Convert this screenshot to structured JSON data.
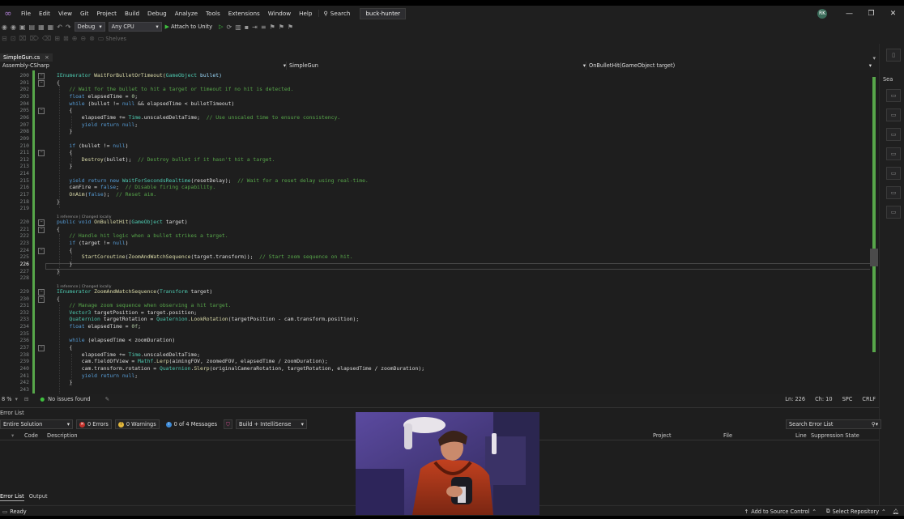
{
  "menu": {
    "items": [
      "File",
      "Edit",
      "View",
      "Git",
      "Project",
      "Build",
      "Debug",
      "Analyze",
      "Tools",
      "Extensions",
      "Window",
      "Help"
    ],
    "search_label": "Search",
    "solution_name": "buck-hunter",
    "user_initials": "RK"
  },
  "toolbar": {
    "config": "Debug",
    "platform": "Any CPU",
    "run_label": "Attach to Unity",
    "shelves_label": "Shelves"
  },
  "tab": {
    "filename": "SimpleGun.cs",
    "close": "×"
  },
  "navbar": {
    "project": "Assembly-CSharp",
    "type": "SimpleGun",
    "member": "OnBulletHit(GameObject target)"
  },
  "code_lines": [
    {
      "n": "200",
      "tokens": [
        [
          "IEnumerator ",
          "ty"
        ],
        [
          "WaitForBulletOrTimeout(",
          "mt"
        ],
        [
          "GameObject",
          "ty"
        ],
        [
          " bullet)",
          "va"
        ]
      ]
    },
    {
      "n": "201",
      "tokens": [
        [
          "{",
          ""
        ]
      ]
    },
    {
      "n": "202",
      "tokens": [
        [
          "    // Wait for the bullet to hit a target or timeout if no hit is detected.",
          "cm"
        ]
      ]
    },
    {
      "n": "203",
      "tokens": [
        [
          "    float ",
          "kw"
        ],
        [
          "elapsedTime = ",
          ""
        ],
        [
          "0",
          "nu"
        ],
        [
          ";",
          ""
        ]
      ]
    },
    {
      "n": "204",
      "tokens": [
        [
          "    while ",
          "kw"
        ],
        [
          "(bullet != ",
          ""
        ],
        [
          "null",
          "kw"
        ],
        [
          " && elapsedTime < bulletTimeout)",
          ""
        ]
      ]
    },
    {
      "n": "205",
      "tokens": [
        [
          "    {",
          ""
        ]
      ]
    },
    {
      "n": "206",
      "tokens": [
        [
          "        elapsedTime += ",
          ""
        ],
        [
          "Time",
          "ty"
        ],
        [
          ".unscaledDeltaTime;  ",
          ""
        ],
        [
          "// Use unscaled time to ensure consistency.",
          "cm"
        ]
      ]
    },
    {
      "n": "207",
      "tokens": [
        [
          "        yield return ",
          "kw"
        ],
        [
          "null",
          "kw"
        ],
        [
          ";",
          ""
        ]
      ]
    },
    {
      "n": "208",
      "tokens": [
        [
          "    }",
          ""
        ]
      ]
    },
    {
      "n": "209",
      "tokens": [
        [
          "",
          ""
        ]
      ]
    },
    {
      "n": "210",
      "tokens": [
        [
          "    if ",
          "kw"
        ],
        [
          "(bullet != ",
          ""
        ],
        [
          "null",
          "kw"
        ],
        [
          ")",
          ""
        ]
      ]
    },
    {
      "n": "211",
      "tokens": [
        [
          "    {",
          ""
        ]
      ]
    },
    {
      "n": "212",
      "tokens": [
        [
          "        ",
          ""
        ],
        [
          "Destroy",
          "mt"
        ],
        [
          "(bullet);  ",
          ""
        ],
        [
          "// Destroy bullet if it hasn't hit a target.",
          "cm"
        ]
      ]
    },
    {
      "n": "213",
      "tokens": [
        [
          "    }",
          ""
        ]
      ]
    },
    {
      "n": "214",
      "tokens": [
        [
          "",
          ""
        ]
      ]
    },
    {
      "n": "215",
      "tokens": [
        [
          "    yield return new ",
          "kw"
        ],
        [
          "WaitForSecondsRealtime",
          "ty"
        ],
        [
          "(resetDelay);  ",
          ""
        ],
        [
          "// Wait for a reset delay using real-time.",
          "cm"
        ]
      ]
    },
    {
      "n": "216",
      "tokens": [
        [
          "    canFire = ",
          ""
        ],
        [
          "false",
          "kw"
        ],
        [
          ";  ",
          ""
        ],
        [
          "// Disable firing capability.",
          "cm"
        ]
      ]
    },
    {
      "n": "217",
      "tokens": [
        [
          "    ",
          ""
        ],
        [
          "OnAim",
          "mt"
        ],
        [
          "(",
          ""
        ],
        [
          "false",
          "kw"
        ],
        [
          ");  ",
          ""
        ],
        [
          "// Reset aim.",
          "cm"
        ]
      ]
    },
    {
      "n": "218",
      "tokens": [
        [
          "}",
          ""
        ]
      ]
    },
    {
      "n": "219",
      "tokens": [
        [
          "",
          ""
        ]
      ]
    },
    {
      "n": "220",
      "tokens": [
        [
          "public void ",
          "kw"
        ],
        [
          "OnBulletHit",
          "mt"
        ],
        [
          "(",
          ""
        ],
        [
          "GameObject",
          "ty"
        ],
        [
          " target)",
          ""
        ]
      ]
    },
    {
      "n": "221",
      "tokens": [
        [
          "{",
          ""
        ]
      ]
    },
    {
      "n": "222",
      "tokens": [
        [
          "    // Handle hit logic when a bullet strikes a target.",
          "cm"
        ]
      ]
    },
    {
      "n": "223",
      "tokens": [
        [
          "    if ",
          "kw"
        ],
        [
          "(target != ",
          ""
        ],
        [
          "null",
          "kw"
        ],
        [
          ")",
          ""
        ]
      ]
    },
    {
      "n": "224",
      "tokens": [
        [
          "    {",
          ""
        ]
      ]
    },
    {
      "n": "225",
      "tokens": [
        [
          "        ",
          ""
        ],
        [
          "StartCoroutine",
          "mt"
        ],
        [
          "(",
          ""
        ],
        [
          "ZoomAndWatchSequence",
          "mt"
        ],
        [
          "(target.transform));  ",
          ""
        ],
        [
          "// Start zoom sequence on hit.",
          "cm"
        ]
      ]
    },
    {
      "n": "226",
      "tokens": [
        [
          "    }",
          ""
        ]
      ]
    },
    {
      "n": "227",
      "tokens": [
        [
          "}",
          ""
        ]
      ]
    },
    {
      "n": "228",
      "tokens": [
        [
          "",
          ""
        ]
      ]
    },
    {
      "n": "229",
      "tokens": [
        [
          "IEnumerator ",
          "ty"
        ],
        [
          "ZoomAndWatchSequence",
          "mt"
        ],
        [
          "(",
          ""
        ],
        [
          "Transform",
          "ty"
        ],
        [
          " target)",
          ""
        ]
      ]
    },
    {
      "n": "230",
      "tokens": [
        [
          "{",
          ""
        ]
      ]
    },
    {
      "n": "231",
      "tokens": [
        [
          "    // Manage zoom sequence when observing a hit target.",
          "cm"
        ]
      ]
    },
    {
      "n": "232",
      "tokens": [
        [
          "    ",
          ""
        ],
        [
          "Vector3",
          "ty"
        ],
        [
          " targetPosition = target.position;",
          ""
        ]
      ]
    },
    {
      "n": "233",
      "tokens": [
        [
          "    ",
          ""
        ],
        [
          "Quaternion",
          "ty"
        ],
        [
          " targetRotation = ",
          ""
        ],
        [
          "Quaternion",
          "ty"
        ],
        [
          ".",
          ""
        ],
        [
          "LookRotation",
          "mt"
        ],
        [
          "(targetPosition - cam.transform.position);",
          ""
        ]
      ]
    },
    {
      "n": "234",
      "tokens": [
        [
          "    float ",
          "kw"
        ],
        [
          "elapsedTime = ",
          ""
        ],
        [
          "0f",
          "nu"
        ],
        [
          ";",
          ""
        ]
      ]
    },
    {
      "n": "235",
      "tokens": [
        [
          "",
          ""
        ]
      ]
    },
    {
      "n": "236",
      "tokens": [
        [
          "    while ",
          "kw"
        ],
        [
          "(elapsedTime < zoomDuration)",
          ""
        ]
      ]
    },
    {
      "n": "237",
      "tokens": [
        [
          "    {",
          ""
        ]
      ]
    },
    {
      "n": "238",
      "tokens": [
        [
          "        elapsedTime += ",
          ""
        ],
        [
          "Time",
          "ty"
        ],
        [
          ".unscaledDeltaTime;",
          ""
        ]
      ]
    },
    {
      "n": "239",
      "tokens": [
        [
          "        cam.fieldOfView = ",
          ""
        ],
        [
          "Mathf",
          "ty"
        ],
        [
          ".",
          ""
        ],
        [
          "Lerp",
          "mt"
        ],
        [
          "(aimingFOV, zoomedFOV, elapsedTime / zoomDuration);",
          ""
        ]
      ]
    },
    {
      "n": "240",
      "tokens": [
        [
          "        cam.transform.rotation = ",
          ""
        ],
        [
          "Quaternion",
          "ty"
        ],
        [
          ".",
          ""
        ],
        [
          "Slerp",
          "mt"
        ],
        [
          "(originalCameraRotation, targetRotation, elapsedTime / zoomDuration);",
          ""
        ]
      ]
    },
    {
      "n": "241",
      "tokens": [
        [
          "        yield return ",
          "kw"
        ],
        [
          "null",
          "kw"
        ],
        [
          ";",
          ""
        ]
      ]
    },
    {
      "n": "242",
      "tokens": [
        [
          "    }",
          ""
        ]
      ]
    },
    {
      "n": "243",
      "tokens": [
        [
          "",
          ""
        ]
      ]
    }
  ],
  "codelens": {
    "label_220": "1 reference | Changed locally",
    "label_229": "1 reference | Changed locally"
  },
  "editor_status": {
    "zoom": "8 %",
    "issues": "No issues found",
    "line": "Ln: 226",
    "col": "Ch: 10",
    "spc": "SPC",
    "eol": "CRLF"
  },
  "error_list": {
    "title": "Error List",
    "scope": "Entire Solution",
    "errors": "0 Errors",
    "warnings": "0 Warnings",
    "messages": "0 of 4 Messages",
    "build_filter": "Build + IntelliSense",
    "search_placeholder": "Search Error List",
    "columns": [
      "Code",
      "Description",
      "Project",
      "File",
      "Line",
      "Suppression State"
    ],
    "tabs": [
      "Error List",
      "Output"
    ]
  },
  "right_panel": {
    "label": "Sea"
  },
  "status_bar": {
    "ready": "Ready",
    "add_source": "Add to Source Control",
    "select_repo": "Select Repository"
  },
  "colors": {
    "accent": "#3a6ea5",
    "modified_margin": "#57a64a",
    "error_badge": "#c5312b",
    "warning_badge": "#e2b73c",
    "info_badge": "#3c8ad8"
  }
}
